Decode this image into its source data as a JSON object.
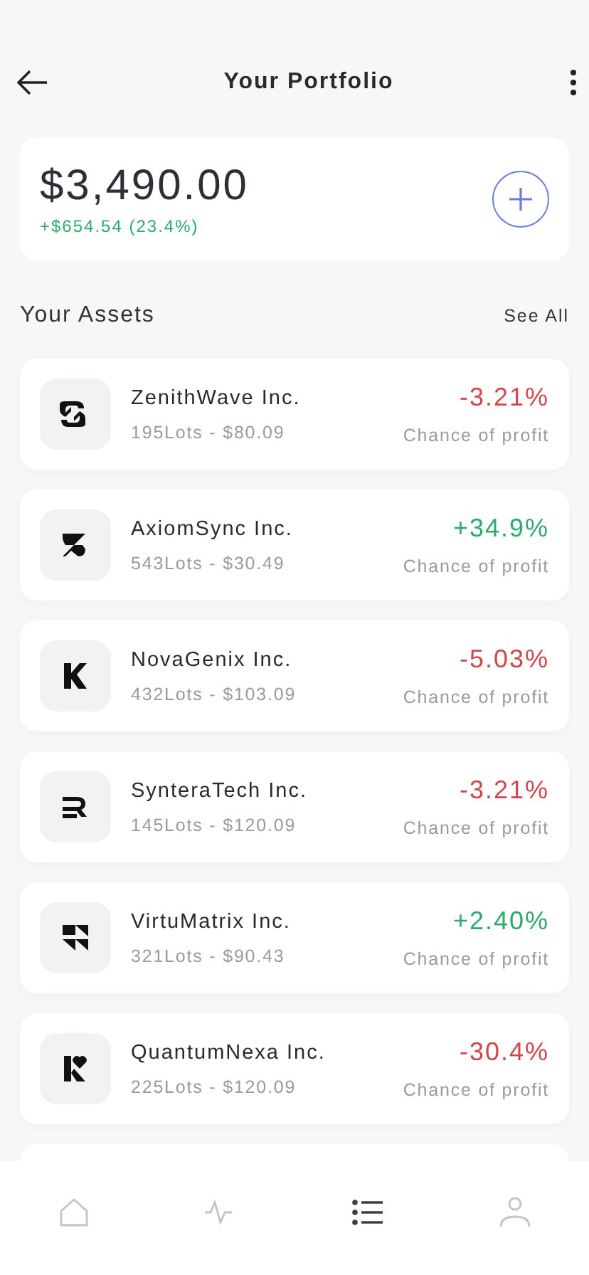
{
  "header": {
    "title": "Your Portfolio"
  },
  "balance": {
    "amount": "$3,490.00",
    "change": "+$654.54 (23.4%)",
    "color": "#2eaa6c"
  },
  "assets_section": {
    "title": "Your Assets",
    "link": "See All"
  },
  "assets": [
    {
      "name": "ZenithWave Inc.",
      "detail": "195Lots - $80.09",
      "change": "-3.21%",
      "color": "#d0484e",
      "caption": "Chance of profit"
    },
    {
      "name": "AxiomSync Inc.",
      "detail": "543Lots - $30.49",
      "change": "+34.9%",
      "color": "#2eaa6c",
      "caption": "Chance of profit"
    },
    {
      "name": "NovaGenix Inc.",
      "detail": "432Lots - $103.09",
      "change": "-5.03%",
      "color": "#d0484e",
      "caption": "Chance of profit"
    },
    {
      "name": "SynteraTech Inc.",
      "detail": "145Lots - $120.09",
      "change": "-3.21%",
      "color": "#d0484e",
      "caption": "Chance of profit"
    },
    {
      "name": "VirtuMatrix Inc.",
      "detail": "321Lots - $90.43",
      "change": "+2.40%",
      "color": "#2eaa6c",
      "caption": "Chance of profit"
    },
    {
      "name": "QuantumNexa Inc.",
      "detail": "225Lots - $120.09",
      "change": "-30.4%",
      "color": "#d0484e",
      "caption": "Chance of profit"
    }
  ],
  "nav": [
    {
      "kind": "home",
      "selected": false
    },
    {
      "kind": "activity",
      "selected": false
    },
    {
      "kind": "list",
      "selected": true
    },
    {
      "kind": "profile",
      "selected": false
    }
  ]
}
